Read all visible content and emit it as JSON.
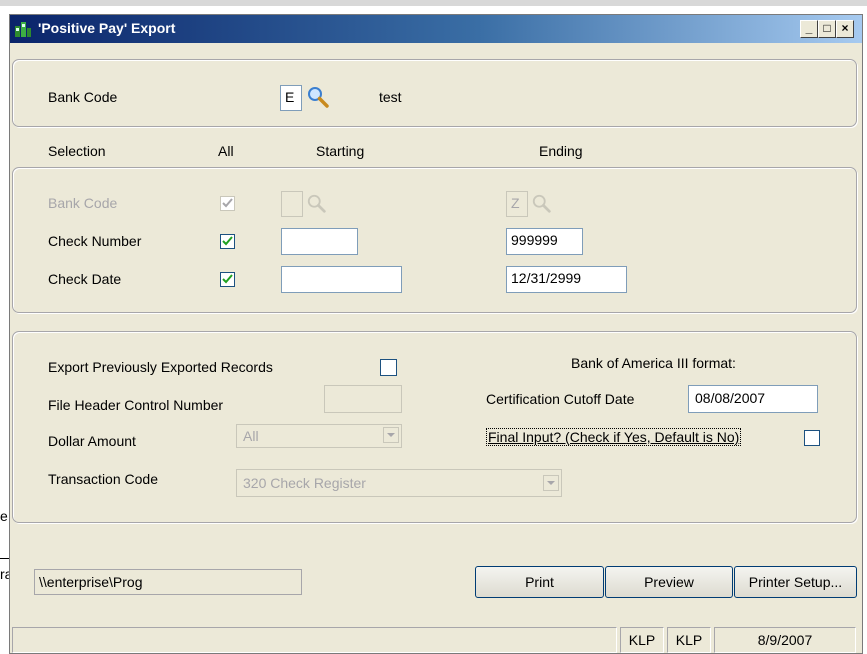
{
  "window": {
    "title": "'Positive Pay' Export",
    "minimize": "_",
    "maximize": "□",
    "close": "×"
  },
  "bank_section": {
    "label": "Bank Code",
    "code": "E",
    "name": "test"
  },
  "selection_header": {
    "selection": "Selection",
    "all": "All",
    "starting": "Starting",
    "ending": "Ending"
  },
  "rows": [
    {
      "label": "Bank Code",
      "all_checked": true,
      "enabled": false,
      "starting": "",
      "ending": "Z"
    },
    {
      "label": "Check Number",
      "all_checked": true,
      "enabled": true,
      "starting": "",
      "ending": "999999"
    },
    {
      "label": "Check Date",
      "all_checked": true,
      "enabled": true,
      "starting": "",
      "ending": "12/31/2999"
    }
  ],
  "options": {
    "export_prev_label": "Export Previously Exported Records",
    "export_prev_checked": false,
    "file_header_label": "File Header Control Number",
    "file_header_value": "",
    "dollar_amount_label": "Dollar Amount",
    "dollar_amount_value": "All",
    "transaction_code_label": "Transaction Code",
    "transaction_code_value": "320 Check Register",
    "boa_format_label": "Bank of America III format:",
    "cert_cutoff_label": "Certification Cutoff Date",
    "cert_cutoff_value": "08/08/2007",
    "final_input_label": "Final Input? (Check if Yes, Default is No)",
    "final_input_checked": false
  },
  "footer": {
    "path": "\\\\enterprise\\Prog",
    "print_label": "Print",
    "preview_label": "Preview",
    "printer_setup_label": "Printer Setup..."
  },
  "statusbar": {
    "user1": "KLP",
    "user2": "KLP",
    "date": "8/9/2007"
  },
  "background_fragments": {
    "right_edge_1": "e",
    "right_edge_2": "ra"
  }
}
